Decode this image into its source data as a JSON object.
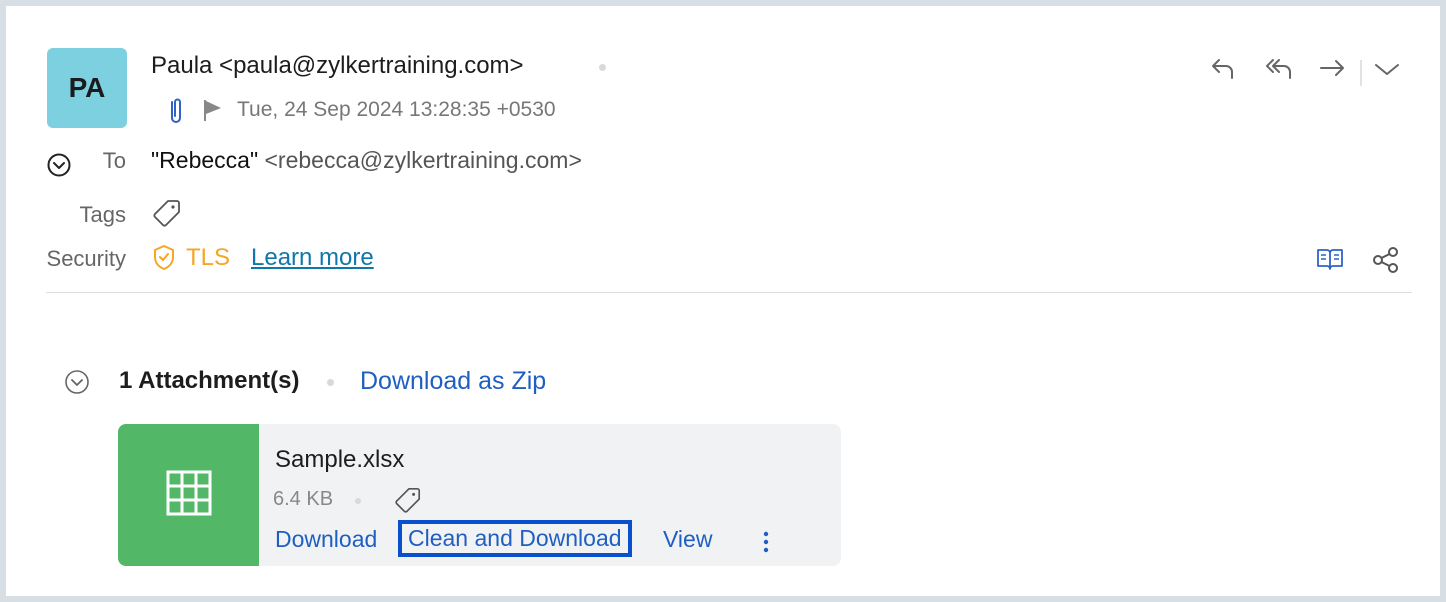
{
  "header": {
    "avatar_initials": "PA",
    "avatar_color": "#7dd0e0",
    "sender": "Paula <paula@zylkertraining.com>",
    "date": "Tue, 24 Sep 2024 13:28:35 +0530",
    "icons": [
      "attachment-icon",
      "flag-icon"
    ]
  },
  "toolbar": {
    "actions": [
      "reply-icon",
      "reply-all-icon",
      "forward-icon",
      "more-chevron-icon"
    ]
  },
  "details": {
    "to_label": "To",
    "to_name": "\"Rebecca\"",
    "to_email": "<rebecca@zylkertraining.com>",
    "tags_label": "Tags",
    "security_label": "Security",
    "security_value": "TLS",
    "learn_more": "Learn more",
    "security_color": "#f5a623",
    "right_icons": [
      "reading-mode-icon",
      "share-icon"
    ]
  },
  "attachments": {
    "title": "1 Attachment(s)",
    "download_zip": "Download as Zip",
    "items": [
      {
        "name": "Sample.xlsx",
        "size": "6.4 KB",
        "file_icon": "spreadsheet-icon",
        "thumb_color": "#52b867",
        "actions": {
          "download": "Download",
          "clean_download": "Clean and Download",
          "view": "View"
        }
      }
    ]
  },
  "colors": {
    "link": "#1f5fc1",
    "highlight_border": "#0a4fcc"
  }
}
